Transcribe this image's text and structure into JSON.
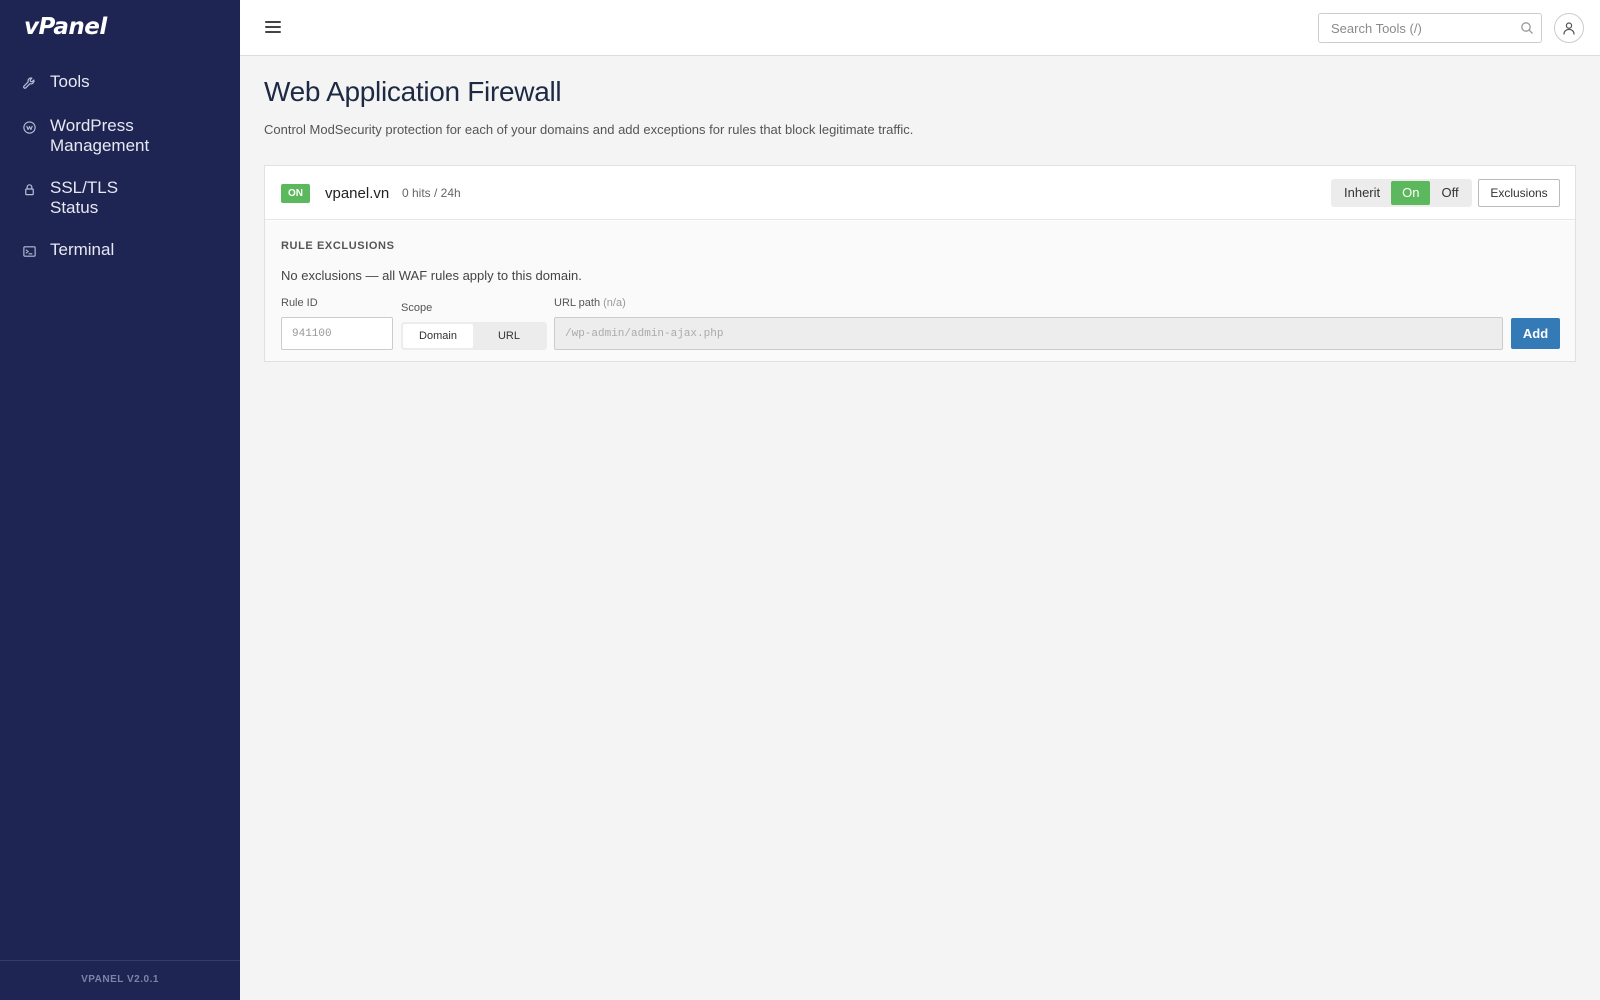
{
  "brand": {
    "logo": "vPanel",
    "version": "VPANEL V2.0.1"
  },
  "sidebar": {
    "items": [
      {
        "label": "Tools",
        "icon": "wrench-icon"
      },
      {
        "label": "WordPress Management",
        "icon": "wordpress-icon"
      },
      {
        "label": "SSL/TLS Status",
        "icon": "lock-icon"
      },
      {
        "label": "Terminal",
        "icon": "terminal-icon"
      }
    ]
  },
  "topbar": {
    "search_placeholder": "Search Tools (/)"
  },
  "page": {
    "title": "Web Application Firewall",
    "description": "Control ModSecurity protection for each of your domains and add exceptions for rules that block legitimate traffic."
  },
  "domain_card": {
    "status_badge": "ON",
    "domain": "vpanel.vn",
    "hits": "0 hits / 24h",
    "mode_options": [
      "Inherit",
      "On",
      "Off"
    ],
    "mode_selected": "On",
    "exclusions_button": "Exclusions",
    "section_title": "RULE EXCLUSIONS",
    "empty_message": "No exclusions — all WAF rules apply to this domain.",
    "form": {
      "rule_id_label": "Rule ID",
      "rule_id_placeholder": "941100",
      "scope_label": "Scope",
      "scope_options": [
        "Domain",
        "URL"
      ],
      "scope_selected": "Domain",
      "url_label": "URL path",
      "url_label_hint": "(n/a)",
      "url_placeholder": "/wp-admin/admin-ajax.php",
      "add_button": "Add"
    }
  },
  "colors": {
    "sidebar_bg": "#1f2553",
    "success": "#5cb85c",
    "primary": "#337ab7",
    "page_bg": "#f4f4f4"
  }
}
